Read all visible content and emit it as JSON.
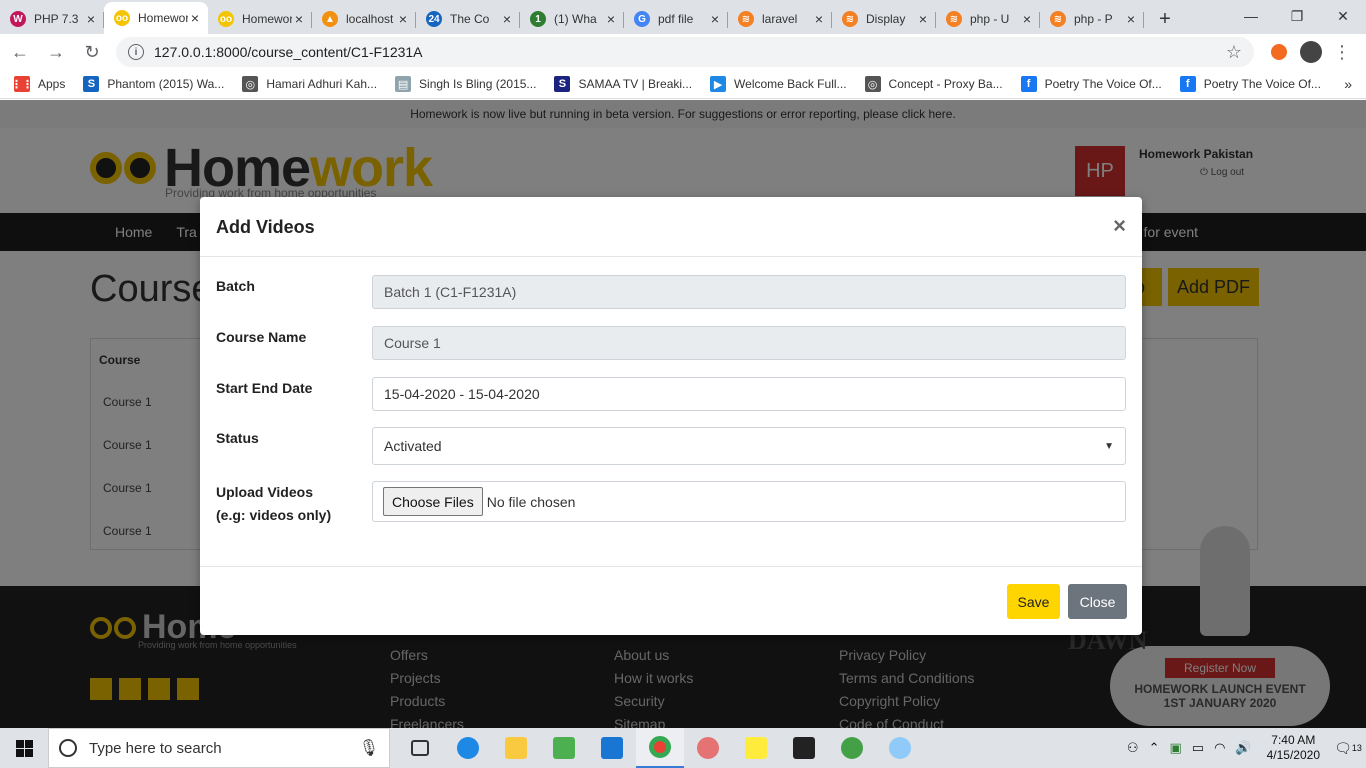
{
  "browser": {
    "tabs": [
      {
        "label": "PHP 7.3",
        "color": "#c2185b",
        "glyph": "W"
      },
      {
        "label": "Homework",
        "color": "#f5c400",
        "glyph": "oo",
        "active": true
      },
      {
        "label": "Homework",
        "color": "#f5c400",
        "glyph": "oo"
      },
      {
        "label": "localhost",
        "color": "#f29111",
        "glyph": "▲"
      },
      {
        "label": "The Co",
        "color": "#1565c0",
        "glyph": "24"
      },
      {
        "label": "(1) Wha",
        "color": "#2e7d32",
        "glyph": "1"
      },
      {
        "label": "pdf file",
        "color": "#4285f4",
        "glyph": "G"
      },
      {
        "label": "laravel",
        "color": "#f48024",
        "glyph": "≋"
      },
      {
        "label": "Display",
        "color": "#f48024",
        "glyph": "≋"
      },
      {
        "label": "php - U",
        "color": "#f48024",
        "glyph": "≋"
      },
      {
        "label": "php - P",
        "color": "#f48024",
        "glyph": "≋"
      }
    ],
    "new_tab": "+",
    "url": "127.0.0.1:8000/course_content/C1-F1231A",
    "bookmarks": [
      {
        "label": "Apps",
        "color": "#e94235",
        "glyph": "⋮⋮"
      },
      {
        "label": "Phantom (2015) Wa...",
        "color": "#1565c0",
        "glyph": "S"
      },
      {
        "label": "Hamari Adhuri Kah...",
        "color": "#555555",
        "glyph": "◎"
      },
      {
        "label": "Singh Is Bling (2015...",
        "color": "#90a4ae",
        "glyph": "▤"
      },
      {
        "label": "SAMAA TV | Breaki...",
        "color": "#1a237e",
        "glyph": "S"
      },
      {
        "label": "Welcome Back Full...",
        "color": "#1e88e5",
        "glyph": "▶"
      },
      {
        "label": "Concept - Proxy Ba...",
        "color": "#555555",
        "glyph": "◎"
      },
      {
        "label": "Poetry The Voice Of...",
        "color": "#1877f2",
        "glyph": "f"
      },
      {
        "label": "Poetry The Voice Of...",
        "color": "#1877f2",
        "glyph": "f"
      }
    ],
    "more": "»"
  },
  "site": {
    "beta_notice": "Homework is now live but running in beta version. For suggestions or error reporting, please click here.",
    "logo_prefix": "Home",
    "logo_suffix": "work",
    "tagline": "Providing work from home opportunities",
    "user_initials": "HP",
    "user_name": "Homework Pakistan",
    "logout": "Log out",
    "nav": [
      "Home",
      "Tra"
    ],
    "nav_right": "ed for event",
    "page_title": "Course",
    "btn_partial": "o",
    "btn_add_pdf": "Add PDF",
    "table_header": "Course",
    "rows": [
      "Course 1",
      "Course 1",
      "Course 1",
      "Course 1"
    ],
    "footer_logo": "Home",
    "footer_tagline": "Providing work from home opportunities",
    "footer_col1": [
      "Offers",
      "Projects",
      "Products",
      "Freelancers"
    ],
    "footer_col2": [
      "About us",
      "How it works",
      "Security",
      "Sitemap"
    ],
    "footer_col3": [
      "Privacy Policy",
      "Terms and Conditions",
      "Copyright Policy",
      "Code of Conduct"
    ],
    "dawn": "DAWN",
    "register": "Register Now",
    "event_line1": "HOMEWORK LAUNCH EVENT",
    "event_line2": "1ST JANUARY 2020"
  },
  "modal": {
    "title": "Add Videos",
    "close_x": "×",
    "fields": {
      "batch_label": "Batch",
      "batch_value": "Batch 1 (C1-F1231A)",
      "course_label": "Course Name",
      "course_value": "Course 1",
      "date_label": "Start End Date",
      "date_value": "15-04-2020 - 15-04-2020",
      "status_label": "Status",
      "status_value": "Activated",
      "upload_label": "Upload Videos",
      "upload_hint": "(e.g: videos only)",
      "choose_files": "Choose Files",
      "no_file": "No file chosen"
    },
    "save": "Save",
    "close": "Close"
  },
  "taskbar": {
    "search_placeholder": "Type here to search",
    "time": "7:40 AM",
    "date": "4/15/2020",
    "notifications": "13"
  }
}
